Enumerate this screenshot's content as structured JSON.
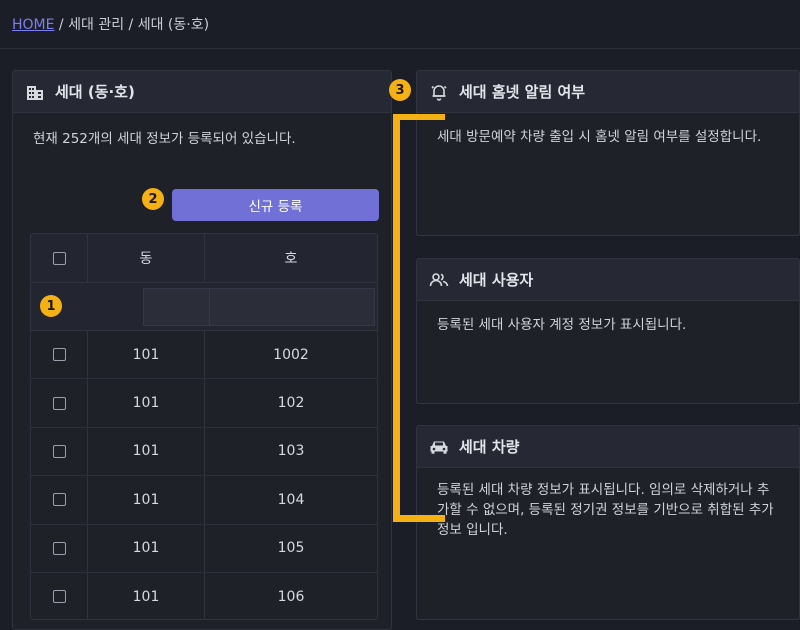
{
  "breadcrumb": {
    "home": "HOME",
    "sep1": " / ",
    "section": "세대 관리",
    "sep2": " / ",
    "current": "세대 (동·호)"
  },
  "left_panel": {
    "title": "세대 (동·호)",
    "description": "현재 252개의 세대 정보가 등록되어 있습니다.",
    "new_button": "신규 등록",
    "table": {
      "headers": {
        "dong": "동",
        "ho": "호"
      },
      "rows": [
        {
          "dong": "101",
          "ho": "1002"
        },
        {
          "dong": "101",
          "ho": "102"
        },
        {
          "dong": "101",
          "ho": "103"
        },
        {
          "dong": "101",
          "ho": "104"
        },
        {
          "dong": "101",
          "ho": "105"
        },
        {
          "dong": "101",
          "ho": "106"
        }
      ]
    }
  },
  "panels": {
    "alarm": {
      "title": "세대 홈넷 알림 여부",
      "body": "세대 방문예약 차량 출입 시 홈넷 알림 여부를 설정합니다."
    },
    "users": {
      "title": "세대 사용자",
      "body": "등록된 세대 사용자 계정 정보가 표시됩니다."
    },
    "vehicle": {
      "title": "세대 차량",
      "body": "등록된 세대 차량 정보가 표시됩니다. 임의로 삭제하거나 추가할 수 없으며, 등록된 정기권 정보를 기반으로 취합된 추가정보 입니다."
    }
  },
  "annotations": {
    "one": "1",
    "two": "2",
    "three": "3"
  },
  "icons": {
    "left": "building-icon",
    "alarm": "bell-icon",
    "users": "users-icon",
    "vehicle": "car-icon"
  },
  "colors": {
    "accent": "#7170d6",
    "annotation": "#f5b014",
    "link": "#7b7ff0"
  }
}
